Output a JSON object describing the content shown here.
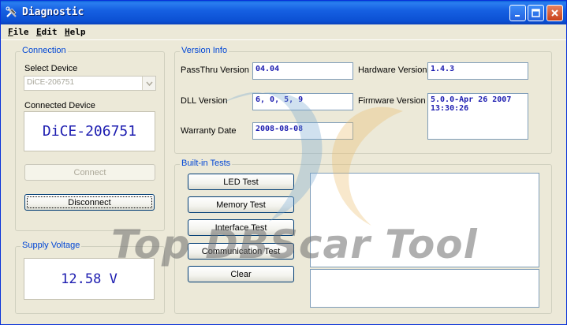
{
  "window": {
    "title": "Diagnostic"
  },
  "menu": [
    {
      "u": "F",
      "rest": "ile"
    },
    {
      "u": "E",
      "rest": "dit"
    },
    {
      "u": "H",
      "rest": "elp"
    }
  ],
  "connection": {
    "title": "Connection",
    "select_label": "Select Device",
    "select_value": "DiCE-206751",
    "connected_label": "Connected Device",
    "connected_value": "DiCE-206751",
    "connect_btn": "Connect",
    "disconnect_btn": "Disconnect"
  },
  "supply": {
    "title": "Supply Voltage",
    "value": "12.58 V"
  },
  "version": {
    "title": "Version Info",
    "passthru_label": "PassThru Version",
    "passthru_value": "04.04",
    "dll_label": "DLL Version",
    "dll_value": "6, 0, 5, 9",
    "warranty_label": "Warranty Date",
    "warranty_value": "2008-08-08",
    "hardware_label": "Hardware Version",
    "hardware_value": "1.4.3",
    "firmware_label": "Firmware Version",
    "firmware_value": "5.0.0-Apr 26 2007\n13:30:26"
  },
  "tests": {
    "title": "Built-in Tests",
    "led": "LED Test",
    "memory": "Memory Test",
    "interface": "Interface Test",
    "communication": "Communication Test",
    "clear": "Clear"
  },
  "watermark": "Top DBScar Tool",
  "colors": {
    "title_bar": "#0b4fd2",
    "group_title": "#0046d5",
    "value_text": "#1c1cb0"
  }
}
